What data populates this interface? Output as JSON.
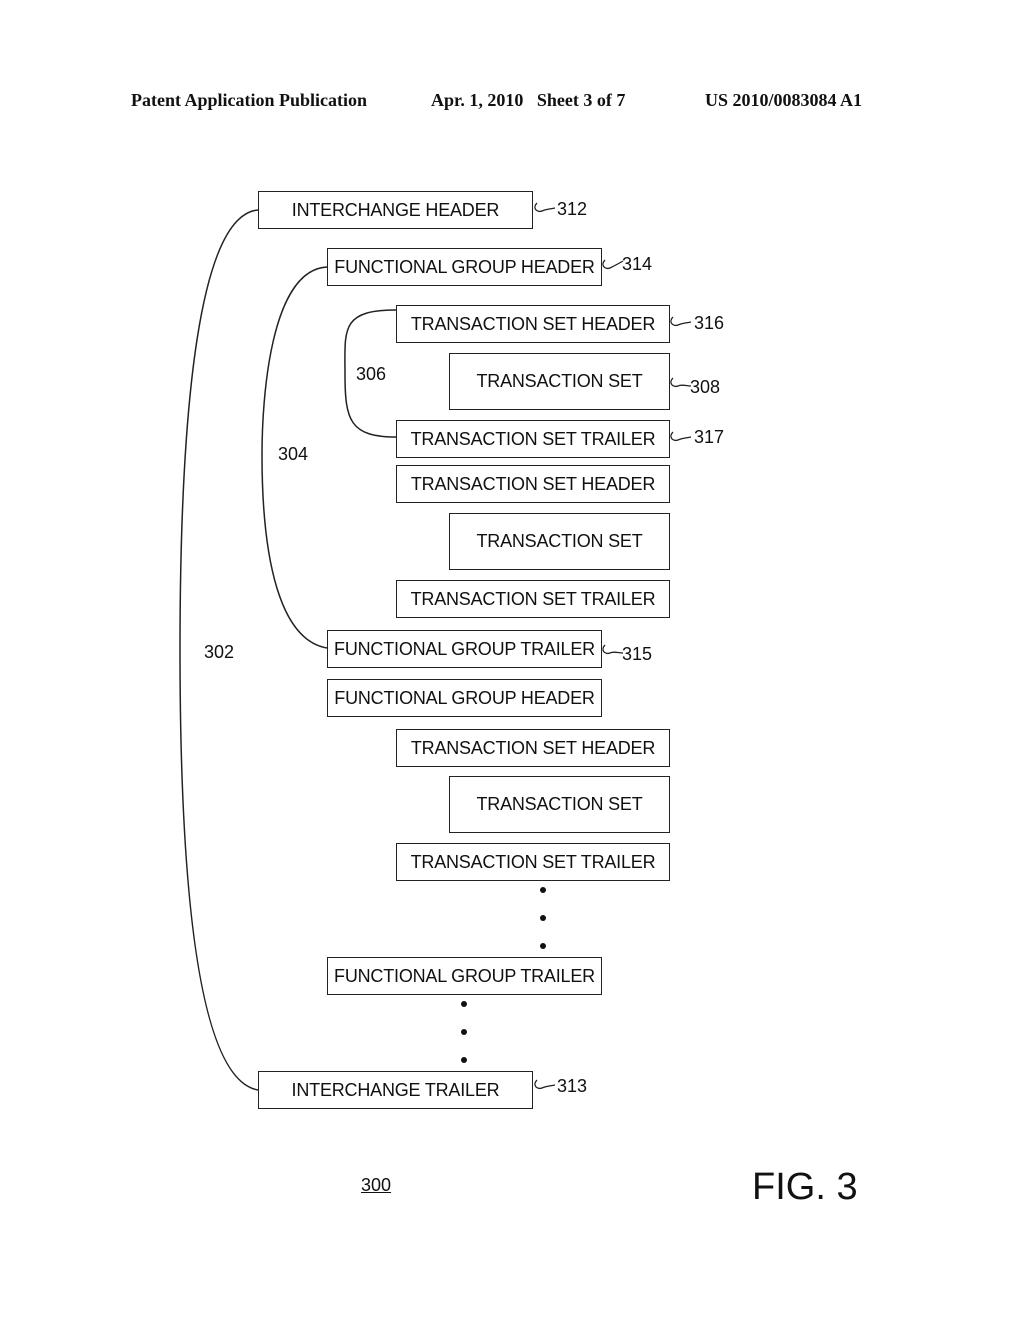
{
  "page_header": {
    "publication": "Patent Application Publication",
    "date_sheet": "Apr. 1, 2010   Sheet 3 of 7",
    "number": "US 2010/0083084 A1"
  },
  "boxes": {
    "interchange_header": "INTERCHANGE HEADER",
    "fg_header_1": "FUNCTIONAL GROUP HEADER",
    "ts_header_1": "TRANSACTION SET HEADER",
    "ts_1": "TRANSACTION SET",
    "ts_trailer_1": "TRANSACTION SET TRAILER",
    "ts_header_2": "TRANSACTION SET HEADER",
    "ts_2": "TRANSACTION SET",
    "ts_trailer_2": "TRANSACTION SET TRAILER",
    "fg_trailer_1": "FUNCTIONAL GROUP TRAILER",
    "fg_header_2": "FUNCTIONAL GROUP HEADER",
    "ts_header_3": "TRANSACTION SET HEADER",
    "ts_3": "TRANSACTION SET",
    "ts_trailer_3": "TRANSACTION SET TRAILER",
    "fg_trailer_2": "FUNCTIONAL GROUP TRAILER",
    "interchange_trailer": "INTERCHANGE TRAILER"
  },
  "refs": {
    "r312": "312",
    "r314": "314",
    "r316": "316",
    "r308": "308",
    "r317": "317",
    "r315": "315",
    "r313": "313",
    "r306": "306",
    "r304": "304",
    "r302": "302"
  },
  "figure": {
    "number": "300",
    "label": "FIG. 3"
  }
}
